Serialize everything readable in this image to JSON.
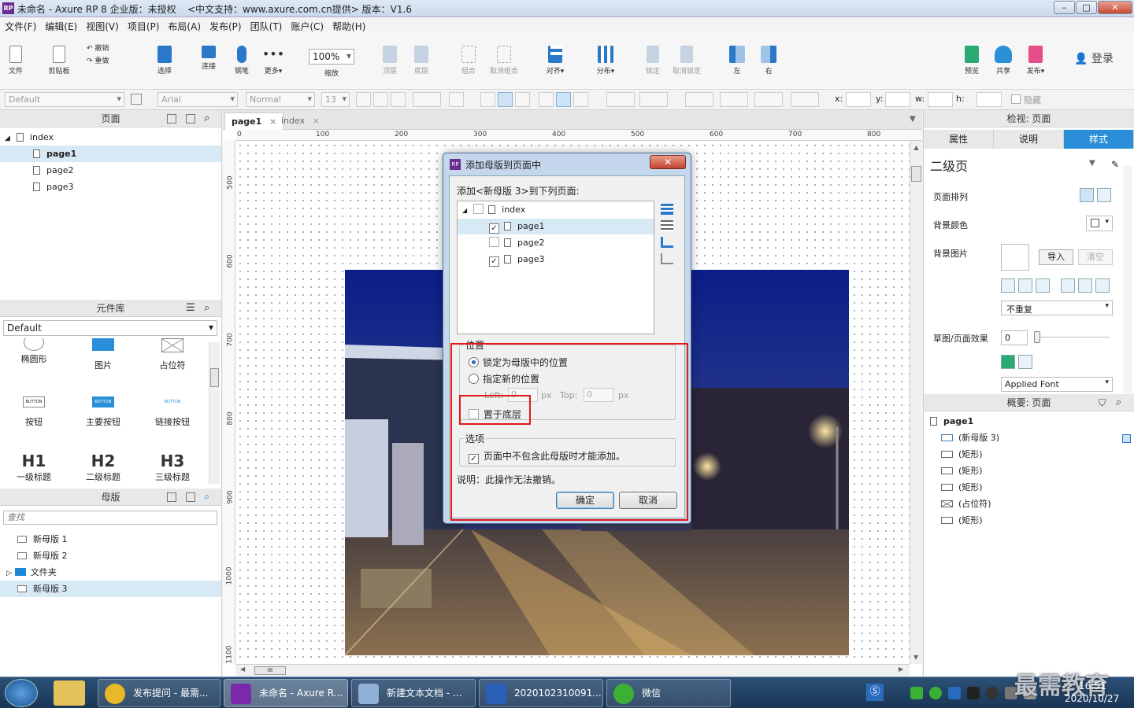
{
  "window": {
    "app_title": "未命名 - Axure RP 8 企业版：未授权",
    "support_text": "<中文支持：www.axure.com.cn提供> 版本：V1.6",
    "logo_text": "RP",
    "min": "–",
    "max": "□",
    "close": "✕"
  },
  "menu": [
    "文件(F)",
    "编辑(E)",
    "视图(V)",
    "项目(P)",
    "布局(A)",
    "发布(P)",
    "团队(T)",
    "账户(C)",
    "帮助(H)"
  ],
  "toolbar": {
    "file": "文件",
    "clipboard": "剪贴板",
    "undo": "撤销",
    "redo": "重做",
    "select": "选择",
    "connect": "连接",
    "pen": "钢笔",
    "more": "更多▾",
    "zoom_value": "100%",
    "zoom_label": "缩放",
    "top": "顶层",
    "bottom": "底层",
    "group": "组合",
    "ungroup": "取消组合",
    "align": "对齐▾",
    "distribute": "分布▾",
    "lock": "锁定",
    "unlock": "取消锁定",
    "left": "左",
    "right": "右",
    "preview": "预览",
    "share": "共享",
    "publish": "发布▾",
    "login": "登录"
  },
  "format": {
    "style": "Default",
    "font": "Arial",
    "weight": "Normal",
    "size": "13",
    "x_label": "x:",
    "y_label": "y:",
    "w_label": "w:",
    "h_label": "h:",
    "hide": "隐藏"
  },
  "pages_panel": {
    "title": "页面",
    "items": [
      {
        "label": "index",
        "level": 0
      },
      {
        "label": "page1",
        "level": 1,
        "selected": true
      },
      {
        "label": "page2",
        "level": 1
      },
      {
        "label": "page3",
        "level": 1
      }
    ]
  },
  "library_panel": {
    "title": "元件库",
    "selected_library": "Default",
    "widgets": [
      {
        "label": "椭圆形"
      },
      {
        "label": "图片"
      },
      {
        "label": "占位符"
      },
      {
        "label": "按钮",
        "glyph": "BUTTON"
      },
      {
        "label": "主要按钮",
        "glyph": "BUTTON"
      },
      {
        "label": "链接按钮",
        "glyph": "BUTTON"
      },
      {
        "label": "一级标题",
        "glyph": "H1"
      },
      {
        "label": "二级标题",
        "glyph": "H2"
      },
      {
        "label": "三级标题",
        "glyph": "H3"
      }
    ]
  },
  "masters_panel": {
    "title": "母版",
    "search_placeholder": "查找",
    "items": [
      {
        "label": "新母版 1",
        "type": "master"
      },
      {
        "label": "新母版 2",
        "type": "master"
      },
      {
        "label": "文件夹",
        "type": "folder"
      },
      {
        "label": "新母版 3",
        "type": "master",
        "selected": true
      }
    ]
  },
  "canvas": {
    "tabs": [
      {
        "label": "page1",
        "active": true
      },
      {
        "label": "index"
      }
    ],
    "ruler_h": [
      "0",
      "100",
      "200",
      "300",
      "400",
      "500",
      "600",
      "700",
      "800"
    ],
    "ruler_v": [
      "500",
      "600",
      "700",
      "800",
      "900",
      "1000",
      "1100"
    ],
    "scroll_grip": "III"
  },
  "dialog": {
    "title": "添加母版到页面中",
    "instruction": "添加<新母版 3>到下列页面:",
    "pages": [
      {
        "label": "index",
        "checked": false,
        "level": 0
      },
      {
        "label": "page1",
        "checked": true,
        "level": 1,
        "selected": true
      },
      {
        "label": "page2",
        "checked": false,
        "level": 1
      },
      {
        "label": "page3",
        "checked": true,
        "level": 1
      }
    ],
    "position_group": "位置",
    "lock_position": "锁定为母版中的位置",
    "new_position": "指定新的位置",
    "left_label": "Left:",
    "left_value": "0",
    "px": "px",
    "top_label": "Top:",
    "top_value": "0",
    "send_to_back": "置于底层",
    "options_group": "选项",
    "option_only_if_absent": "页面中不包含此母版时才能添加。",
    "note": "说明：此操作无法撤销。",
    "ok": "确定",
    "cancel": "取消",
    "check_mark": "✓"
  },
  "inspector": {
    "title": "检视: 页面",
    "tabs": [
      "属性",
      "说明",
      "样式"
    ],
    "active_tab": "样式",
    "page_style": "二级页",
    "page_align": "页面排列",
    "bg_color": "背景颜色",
    "bg_image": "背景图片",
    "import": "导入",
    "clear": "清空",
    "repeat": "不重复",
    "sketch": "草图/页面效果",
    "sketch_value": "0",
    "font": "Applied Font"
  },
  "outline": {
    "title": "概要: 页面",
    "root": "page1",
    "items": [
      {
        "label": "(新母版 3)",
        "icon": "master"
      },
      {
        "label": "(矩形)",
        "icon": "rect"
      },
      {
        "label": "(矩形)",
        "icon": "rect"
      },
      {
        "label": "(矩形)",
        "icon": "rect"
      },
      {
        "label": "(占位符)",
        "icon": "placeholder"
      },
      {
        "label": "(矩形)",
        "icon": "rect"
      }
    ]
  },
  "taskbar": {
    "tasks": [
      {
        "label": "发布提问 - 最需...",
        "icon_color": "#e8b828"
      },
      {
        "label": "未命名 - Axure R...",
        "icon_color": "#7a2aa8"
      },
      {
        "label": "新建文本文档 - ...",
        "icon_color": "#8fb0d6"
      },
      {
        "label": "2020102310091...",
        "icon_color": "#2b5fb8"
      },
      {
        "label": "微信",
        "icon_color": "#3cb034"
      }
    ],
    "time": "16:51",
    "date": "2020/10/27",
    "watermark": "最需教育"
  },
  "colors": {
    "accent": "#2a8fd8",
    "highlight_red": "#e01818",
    "tab_active": "#2a8fd8"
  }
}
